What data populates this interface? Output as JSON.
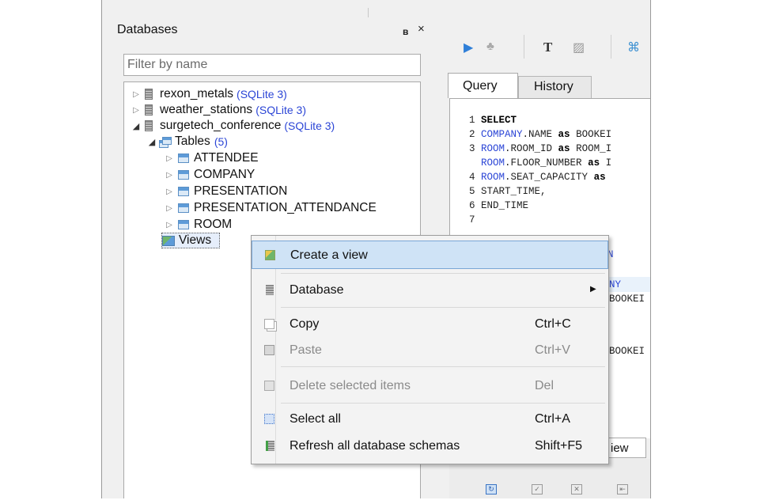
{
  "panel": {
    "title": "Databases",
    "float_glyph": "ʙ",
    "close_glyph": "×",
    "filter_placeholder": "Filter by name"
  },
  "tree": {
    "databases": [
      {
        "name": "rexon_metals",
        "type": "(SQLite 3)",
        "expanded": false
      },
      {
        "name": "weather_stations",
        "type": "(SQLite 3)",
        "expanded": false
      },
      {
        "name": "surgetech_conference",
        "type": "(SQLite 3)",
        "expanded": true
      }
    ],
    "tables_label": "Tables",
    "tables_count": "(5)",
    "tables": [
      "ATTENDEE",
      "COMPANY",
      "PRESENTATION",
      "PRESENTATION_ATTENDANCE",
      "ROOM"
    ],
    "views_label": "Views"
  },
  "editor": {
    "tabs": {
      "query": "Query",
      "history": "History"
    },
    "lines": [
      {
        "num": "1",
        "segments": [
          {
            "t": "SELECT",
            "c": "kw"
          }
        ]
      },
      {
        "num": "2",
        "segments": [
          {
            "t": "COMPANY",
            "c": "tb-name"
          },
          {
            "t": ".NAME ",
            "c": ""
          },
          {
            "t": "as",
            "c": "kw"
          },
          {
            "t": " BOOKEI",
            "c": ""
          }
        ]
      },
      {
        "num": "3",
        "segments": [
          {
            "t": "ROOM",
            "c": "tb-name"
          },
          {
            "t": ".ROOM_ID ",
            "c": ""
          },
          {
            "t": "as",
            "c": "kw"
          },
          {
            "t": " ROOM_I",
            "c": ""
          }
        ]
      },
      {
        "num": "",
        "segments": [
          {
            "t": "ROOM",
            "c": "tb-name"
          },
          {
            "t": ".FLOOR_NUMBER ",
            "c": ""
          },
          {
            "t": "as",
            "c": "kw"
          },
          {
            "t": " I",
            "c": ""
          }
        ]
      },
      {
        "num": "4",
        "segments": [
          {
            "t": "ROOM",
            "c": "tb-name"
          },
          {
            "t": ".SEAT_CAPACITY ",
            "c": ""
          },
          {
            "t": "as",
            "c": "kw"
          }
        ]
      },
      {
        "num": "5",
        "segments": [
          {
            "t": "START_TIME,",
            "c": ""
          }
        ]
      },
      {
        "num": "6",
        "segments": [
          {
            "t": "END_TIME",
            "c": ""
          }
        ]
      },
      {
        "num": "7",
        "segments": []
      }
    ],
    "partial": {
      "n": "N",
      "ny": "NY",
      "booked1": "BOOKEI",
      "booked2": "BOOKEI"
    },
    "bottom_tab": "iew"
  },
  "context_menu": {
    "items": [
      {
        "label": "Create a view",
        "shortcut": "",
        "icon": "create-view-icon",
        "enabled": true,
        "highlighted": true
      },
      {
        "label": "Database",
        "shortcut": "",
        "icon": "database-icon",
        "enabled": true,
        "submenu": true
      },
      {
        "label": "Copy",
        "shortcut": "Ctrl+C",
        "icon": "copy-icon",
        "enabled": true
      },
      {
        "label": "Paste",
        "shortcut": "Ctrl+V",
        "icon": "paste-icon",
        "enabled": false
      },
      {
        "label": "Delete selected items",
        "shortcut": "Del",
        "icon": "delete-icon",
        "enabled": false
      },
      {
        "label": "Select all",
        "shortcut": "Ctrl+A",
        "icon": "select-all-icon",
        "enabled": true
      },
      {
        "label": "Refresh all database schemas",
        "shortcut": "Shift+F5",
        "icon": "refresh-icon",
        "enabled": true
      }
    ]
  },
  "colors": {
    "link_blue": "#2b45d6",
    "selection": "#cfe3f6",
    "panel_bg": "#f0f0f0"
  }
}
